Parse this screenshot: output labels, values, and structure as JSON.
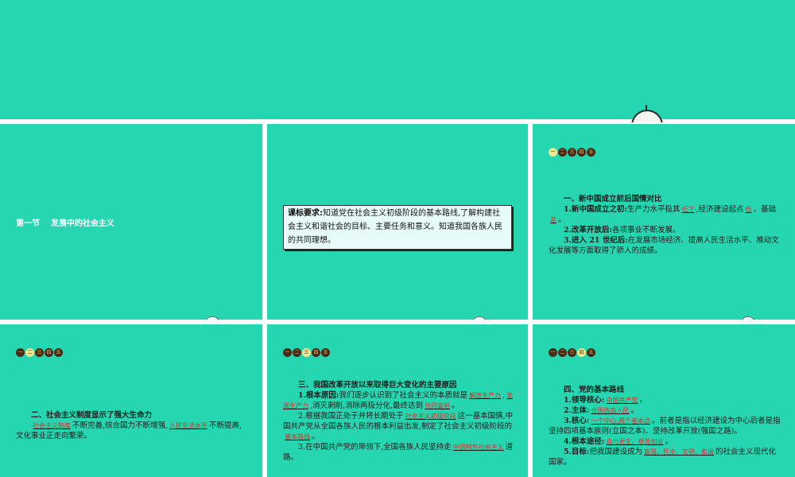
{
  "nav_labels": [
    "一",
    "二",
    "三",
    "四",
    "五"
  ],
  "slide1": {
    "title": "第一节    发展中的社会主义"
  },
  "slide2": {
    "req_label": "课标要求:",
    "req_text": "知道党在社会主义初级阶段的基本路线,了解构建社会主义和谐社会的目标、主要任务和意义。知道我国各族人民的共同理想。"
  },
  "slide3": {
    "heading": "一、新中国成立前后国情对比",
    "p1_label": "1.新中国成立之初:",
    "p1_a": "生产力水平极其",
    "p1_ans1": "低下",
    "p1_b": ",经济建设起点",
    "p1_ans2": "低",
    "p1_c": "、基础",
    "p1_ans3": "差",
    "p1_d": "。",
    "p2_label": "2.改革开放后:",
    "p2_text": "各项事业不断发展。",
    "p3_label": "3.进入 21 世纪后:",
    "p3_text": "在发展市场经济、提高人民生活水平、推动文化发展等方面取得了骄人的成绩。"
  },
  "slide4": {
    "heading": "二、社会主义制度显示了强大生命力",
    "ans1": "社会主义制度",
    "t1": "不断完善,综合国力不断增强,",
    "ans2": "人民生活水平",
    "t2": "不断提高,文化事业正走向繁荣。"
  },
  "slide5": {
    "heading": "三、我国改革开放以来取得巨大变化的主要原因",
    "p1_label": "1.根本原因:",
    "p1_a": "我们逐步认识到了社会主义的本质就是",
    "p1_ans1": "解放生产力",
    "p1_sep": ",",
    "p1_ans2": "发展生产力",
    "p1_b": ",消灭剥削,消除两极分化,最终达到",
    "p1_ans3": "共同富裕",
    "p1_c": "。",
    "p2_a": "2.根据我国正处于并将长期处于",
    "p2_ans1": "社会主义初级阶段",
    "p2_b": "这一基本国情,中国共产党从全国各族人民的根本利益出发,制定了社会主义初级阶段的",
    "p2_ans2": "基本路线",
    "p2_c": "。",
    "p3_a": "3.在中国共产党的带领下,全国各族人民坚持走",
    "p3_ans": "中国特色社会主义",
    "p3_b": "道路。"
  },
  "slide6": {
    "heading": "四、党的基本路线",
    "p1_label": "1.领导核心:",
    "p1_ans": "中国共产党",
    "p2_label": "2.主体:",
    "p2_ans": "全国各族人民",
    "p3_label": "3.核心:",
    "p3_ans": "一个中心,两个基本点",
    "p3_text": "。前者是指以经济建设为中心后者是指坚持四项基本原则(立国之本)、坚持改革开放(强国之路)。",
    "p4_label": "4.根本途径:",
    "p4_ans": "自力更生、艰苦创业",
    "p5_label": "5.目标:",
    "p5_a": "把我国建设成为",
    "p5_ans": "富强、民主、文明、和谐",
    "p5_b": "的社会主义现代化国家。",
    "period": "。"
  },
  "colors": {
    "background": "#26d6b0",
    "answer": "#d8342c",
    "box": "#e8fbfb"
  }
}
